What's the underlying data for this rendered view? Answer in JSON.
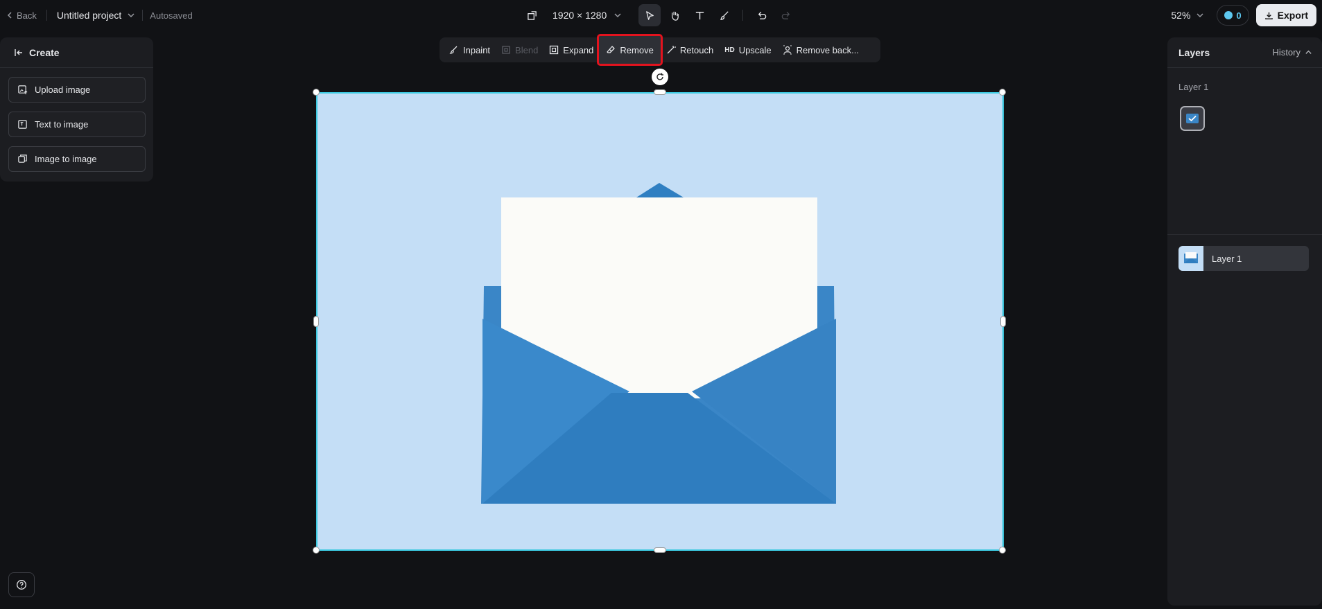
{
  "topbar": {
    "back_label": "Back",
    "project_name": "Untitled project",
    "autosaved": "Autosaved",
    "canvas_size": "1920 × 1280",
    "zoom": "52%",
    "credits": "0",
    "export_label": "Export"
  },
  "left_panel": {
    "title": "Create",
    "buttons": [
      "Upload image",
      "Text to image",
      "Image to image"
    ]
  },
  "context_toolbar": {
    "items": [
      "Inpaint",
      "Blend",
      "Expand",
      "Remove",
      "Retouch",
      "Upscale",
      "Remove back..."
    ],
    "upscale_badge": "HD",
    "highlighted": "Remove"
  },
  "right_panel": {
    "tab_layers": "Layers",
    "tab_history": "History",
    "section_label": "Layer 1",
    "layer_name": "Layer 1"
  },
  "colors": {
    "accent": "#3cc9e0",
    "highlight": "#e3131e",
    "canvas_bg": "#c2ddf5",
    "envelope": "#3b88c9"
  }
}
